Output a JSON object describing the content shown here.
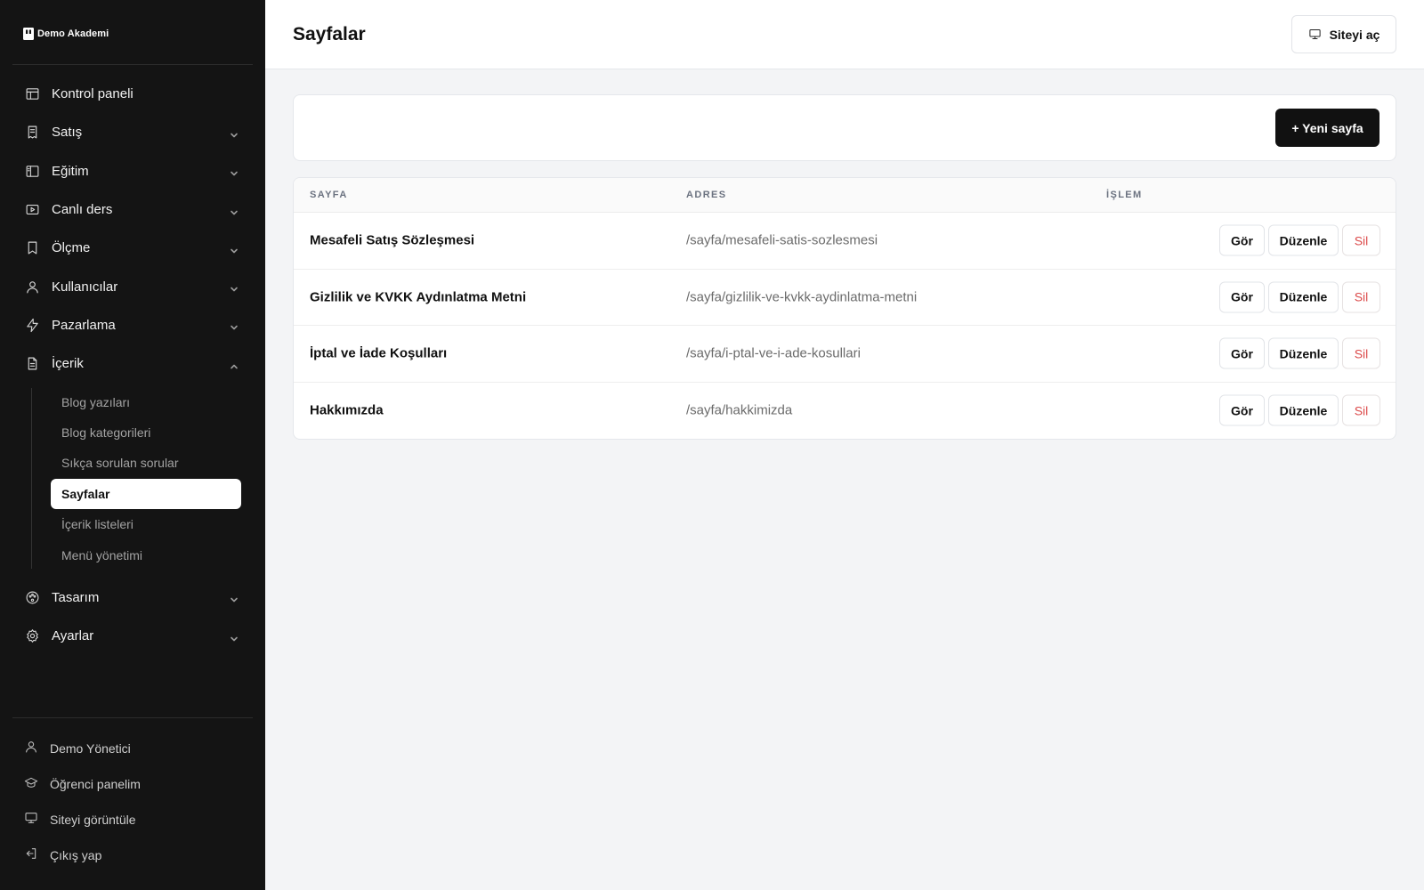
{
  "brand": {
    "name": "Demo Akademi"
  },
  "nav": {
    "items": [
      {
        "label": "Kontrol paneli",
        "icon": "dashboard-icon",
        "has_chevron": false
      },
      {
        "label": "Satış",
        "icon": "receipt-icon",
        "has_chevron": true
      },
      {
        "label": "Eğitim",
        "icon": "book-icon",
        "has_chevron": true
      },
      {
        "label": "Canlı ders",
        "icon": "video-icon",
        "has_chevron": true
      },
      {
        "label": "Ölçme",
        "icon": "bookmark-icon",
        "has_chevron": true
      },
      {
        "label": "Kullanıcılar",
        "icon": "user-icon",
        "has_chevron": true
      },
      {
        "label": "Pazarlama",
        "icon": "bolt-icon",
        "has_chevron": true
      },
      {
        "label": "İçerik",
        "icon": "document-icon",
        "has_chevron": true,
        "expanded": true
      }
    ],
    "content_sub": [
      {
        "label": "Blog yazıları"
      },
      {
        "label": "Blog kategorileri"
      },
      {
        "label": "Sıkça sorulan sorular"
      },
      {
        "label": "Sayfalar",
        "active": true
      },
      {
        "label": "İçerik listeleri"
      },
      {
        "label": "Menü yönetimi"
      }
    ],
    "items_after": [
      {
        "label": "Tasarım",
        "icon": "palette-icon",
        "has_chevron": true
      },
      {
        "label": "Ayarlar",
        "icon": "gear-icon",
        "has_chevron": true
      }
    ]
  },
  "footer": {
    "items": [
      {
        "label": "Demo Yönetici",
        "icon": "user-icon"
      },
      {
        "label": "Öğrenci panelim",
        "icon": "graduation-cap-icon"
      },
      {
        "label": "Siteyi görüntüle",
        "icon": "monitor-icon"
      },
      {
        "label": "Çıkış yap",
        "icon": "logout-icon"
      }
    ]
  },
  "header": {
    "title": "Sayfalar",
    "open_site_label": "Siteyi aç"
  },
  "toolbar": {
    "new_page_label": "+ Yeni sayfa"
  },
  "table": {
    "columns": [
      "SAYFA",
      "ADRES",
      "İŞLEM"
    ],
    "rows": [
      {
        "name": "Mesafeli Satış Sözleşmesi",
        "url": "/sayfa/mesafeli-satis-sozlesmesi"
      },
      {
        "name": "Gizlilik ve KVKK Aydınlatma Metni",
        "url": "/sayfa/gizlilik-ve-kvkk-aydinlatma-metni"
      },
      {
        "name": "İptal ve İade Koşulları",
        "url": "/sayfa/i-ptal-ve-i-ade-kosullari"
      },
      {
        "name": "Hakkımızda",
        "url": "/sayfa/hakkimizda"
      }
    ],
    "actions": {
      "view": "Gör",
      "edit": "Düzenle",
      "delete": "Sil"
    }
  },
  "colors": {
    "sidebar_bg": "#141414",
    "accent": "#111111",
    "danger": "#dc4b4b"
  }
}
